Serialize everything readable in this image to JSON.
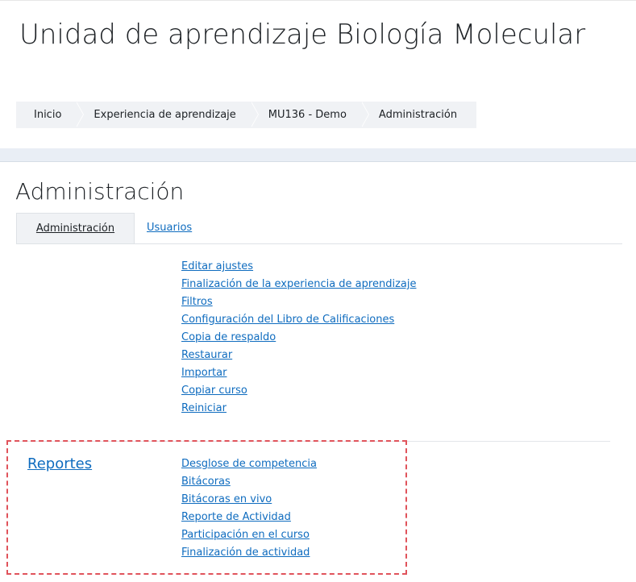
{
  "header": {
    "title": "Unidad de aprendizaje Biología Molecular"
  },
  "breadcrumb": [
    {
      "label": "Inicio"
    },
    {
      "label": "Experiencia de aprendizaje"
    },
    {
      "label": "MU136 - Demo"
    },
    {
      "label": "Administración"
    }
  ],
  "main": {
    "heading": "Administración",
    "tabs": [
      {
        "label": "Administración",
        "active": true
      },
      {
        "label": "Usuarios",
        "active": false
      }
    ],
    "admin_links": [
      "Editar ajustes",
      "Finalización de la experiencia de aprendizaje",
      "Filtros",
      "Configuración del Libro de Calificaciones",
      "Copia de respaldo",
      "Restaurar",
      "Importar",
      "Copiar curso",
      "Reiniciar"
    ],
    "reports": {
      "heading": "Reportes",
      "links": [
        "Desglose de competencia",
        "Bitácoras",
        "Bitácoras en vivo",
        "Reporte de Actividad",
        "Participación en el curso",
        "Finalización de actividad"
      ]
    }
  },
  "colors": {
    "link": "#0f6cbf",
    "highlight_border": "#e0535b",
    "band": "#e9eef5"
  }
}
